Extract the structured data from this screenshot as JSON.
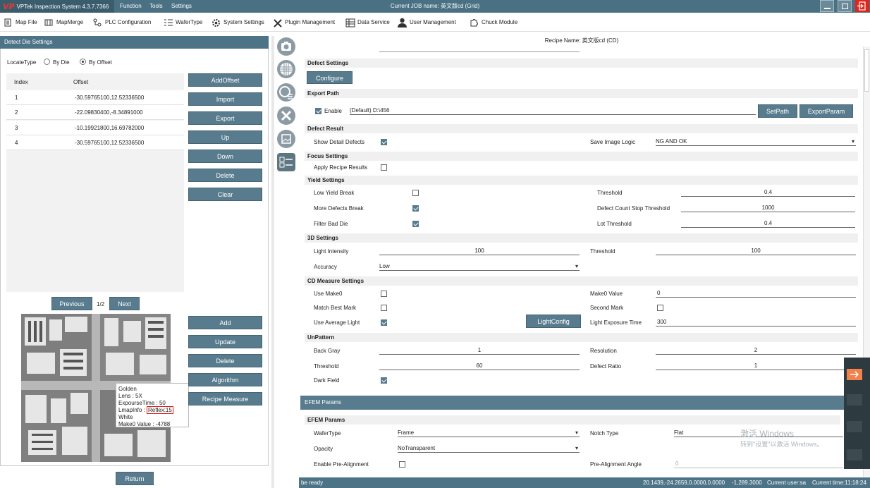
{
  "app": {
    "brand": "VPTek Inspection System 4.3.7.7366",
    "menu": [
      "Function",
      "Tools",
      "Settings"
    ],
    "job": "Current JOB name: 英文版cd (Grid)"
  },
  "toolbar": [
    "Map File",
    "MapMerge",
    "PLC Configuration",
    "WaferType",
    "System Settings",
    "Plugin Management",
    "Data Service",
    "User Management",
    "Chuck Module"
  ],
  "left": {
    "title": "Detect Die Settings",
    "locate_label": "LocateType",
    "opt_die": "By Die",
    "opt_offset": "By Offset",
    "col_index": "Index",
    "col_offset": "Offset",
    "rows": [
      {
        "i": "1",
        "v": "-30.59765100,12.52336500"
      },
      {
        "i": "2",
        "v": "-22.09830400,-8.34891000"
      },
      {
        "i": "3",
        "v": "-10.19921800,16.69782000"
      },
      {
        "i": "4",
        "v": "-30.59765100,12.52336500"
      }
    ],
    "buttons": [
      "AddOffset",
      "Import",
      "Export",
      "Up",
      "Down",
      "Delete",
      "Clear"
    ],
    "prev": "Previous",
    "page": "1/2",
    "next": "Next",
    "buttons2": [
      "Add",
      "Update",
      "Delete",
      "Algorithm",
      "Recipe Measure"
    ],
    "tooltip": {
      "l1": "Golden",
      "l2": "Lens : 5X",
      "l3": "ExpourseTime : 50",
      "l4a": "LmapInfo : ",
      "l4b": "Reflex:15",
      "l4c": " White",
      "l5": "Make0 Value : -4788"
    },
    "return": "Return"
  },
  "recipe": "Recipe Name: 英文版cd (CD)",
  "sections": {
    "defect": "Defect Settings",
    "export": "Export Path",
    "result": "Defect Result",
    "focus": "Focus Settings",
    "yield": "Yield Settings",
    "s3d": "3D Settings",
    "cd": "CD Measure Settings",
    "unpattern": "UnPattern",
    "efem_bar": "EFEM Params",
    "efem": "EFEM Params"
  },
  "configure": "Configure",
  "export": {
    "enable": "Enable",
    "path": "(Default) D:\\456",
    "setpath": "SetPath",
    "exportparam": "ExportParam"
  },
  "result": {
    "show": "Show Detail Defects",
    "save_label": "Save Image Logic",
    "save_val": "NG AND OK"
  },
  "focus": {
    "apply": "Apply Recipe Results"
  },
  "yield": {
    "low": "Low Yield Break",
    "thr": "Threshold",
    "thr_v": "0.4",
    "more": "More Defects Break",
    "dcs": "Defect Count Stop Threshold",
    "dcs_v": "1000",
    "filter": "Filter Bad Die",
    "lot": "Lot Threshold",
    "lot_v": "0.4"
  },
  "s3d": {
    "light": "Light Intensity",
    "light_v": "100",
    "thr": "Threshold",
    "thr_v": "100",
    "acc": "Accuracy",
    "acc_v": "Low"
  },
  "cd": {
    "make0": "Use Make0",
    "make0v": "Make0 Value",
    "make0v_v": "0",
    "match": "Match Best Mark",
    "second": "Second Mark",
    "avg": "Use Average Light",
    "lightcfg": "LightConfig",
    "exp": "Light Exposure Time",
    "exp_v": "300"
  },
  "unp": {
    "bg": "Back Gray",
    "bg_v": "1",
    "res": "Resolution",
    "res_v": "2",
    "thr": "Threshold",
    "thr_v": "60",
    "ratio": "Defect Ratio",
    "ratio_v": "1",
    "dark": "Dark Field"
  },
  "efem": {
    "wt": "WaferType",
    "wt_v": "Frame",
    "notch": "Notch Type",
    "notch_v": "Flat",
    "op": "Opacity",
    "op_v": "NoTransparent",
    "pre": "Enable Pre-Alignment",
    "angle": "Pre-Alignment Angle",
    "angle_v": "0"
  },
  "status": {
    "left": "be ready",
    "coords": "20.1439,-24.2659,0.0000,0.0000",
    "z": "-1,289.3000",
    "user": "Current user:sa",
    "time": "Current time:11:18:24"
  },
  "watermark": {
    "l1": "激活 Windows",
    "l2": "转到\"设置\"以激活 Windows。"
  }
}
